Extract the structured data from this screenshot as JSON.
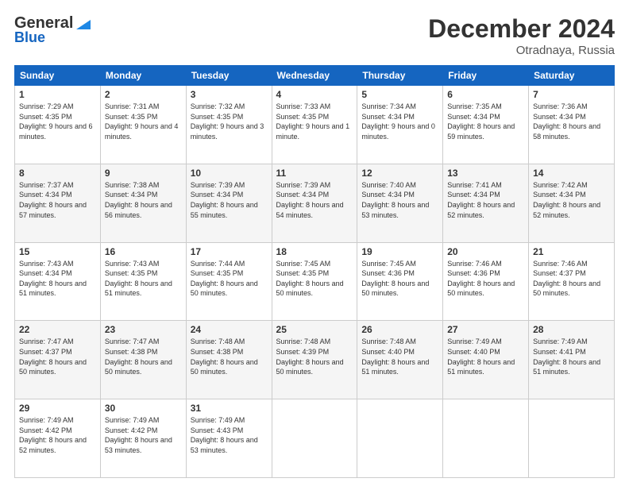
{
  "header": {
    "logo_general": "General",
    "logo_blue": "Blue",
    "month_title": "December 2024",
    "location": "Otradnaya, Russia"
  },
  "weekdays": [
    "Sunday",
    "Monday",
    "Tuesday",
    "Wednesday",
    "Thursday",
    "Friday",
    "Saturday"
  ],
  "weeks": [
    [
      {
        "day": "1",
        "sunrise": "7:29 AM",
        "sunset": "4:35 PM",
        "daylight": "9 hours and 6 minutes."
      },
      {
        "day": "2",
        "sunrise": "7:31 AM",
        "sunset": "4:35 PM",
        "daylight": "9 hours and 4 minutes."
      },
      {
        "day": "3",
        "sunrise": "7:32 AM",
        "sunset": "4:35 PM",
        "daylight": "9 hours and 3 minutes."
      },
      {
        "day": "4",
        "sunrise": "7:33 AM",
        "sunset": "4:35 PM",
        "daylight": "9 hours and 1 minute."
      },
      {
        "day": "5",
        "sunrise": "7:34 AM",
        "sunset": "4:34 PM",
        "daylight": "9 hours and 0 minutes."
      },
      {
        "day": "6",
        "sunrise": "7:35 AM",
        "sunset": "4:34 PM",
        "daylight": "8 hours and 59 minutes."
      },
      {
        "day": "7",
        "sunrise": "7:36 AM",
        "sunset": "4:34 PM",
        "daylight": "8 hours and 58 minutes."
      }
    ],
    [
      {
        "day": "8",
        "sunrise": "7:37 AM",
        "sunset": "4:34 PM",
        "daylight": "8 hours and 57 minutes."
      },
      {
        "day": "9",
        "sunrise": "7:38 AM",
        "sunset": "4:34 PM",
        "daylight": "8 hours and 56 minutes."
      },
      {
        "day": "10",
        "sunrise": "7:39 AM",
        "sunset": "4:34 PM",
        "daylight": "8 hours and 55 minutes."
      },
      {
        "day": "11",
        "sunrise": "7:39 AM",
        "sunset": "4:34 PM",
        "daylight": "8 hours and 54 minutes."
      },
      {
        "day": "12",
        "sunrise": "7:40 AM",
        "sunset": "4:34 PM",
        "daylight": "8 hours and 53 minutes."
      },
      {
        "day": "13",
        "sunrise": "7:41 AM",
        "sunset": "4:34 PM",
        "daylight": "8 hours and 52 minutes."
      },
      {
        "day": "14",
        "sunrise": "7:42 AM",
        "sunset": "4:34 PM",
        "daylight": "8 hours and 52 minutes."
      }
    ],
    [
      {
        "day": "15",
        "sunrise": "7:43 AM",
        "sunset": "4:34 PM",
        "daylight": "8 hours and 51 minutes."
      },
      {
        "day": "16",
        "sunrise": "7:43 AM",
        "sunset": "4:35 PM",
        "daylight": "8 hours and 51 minutes."
      },
      {
        "day": "17",
        "sunrise": "7:44 AM",
        "sunset": "4:35 PM",
        "daylight": "8 hours and 50 minutes."
      },
      {
        "day": "18",
        "sunrise": "7:45 AM",
        "sunset": "4:35 PM",
        "daylight": "8 hours and 50 minutes."
      },
      {
        "day": "19",
        "sunrise": "7:45 AM",
        "sunset": "4:36 PM",
        "daylight": "8 hours and 50 minutes."
      },
      {
        "day": "20",
        "sunrise": "7:46 AM",
        "sunset": "4:36 PM",
        "daylight": "8 hours and 50 minutes."
      },
      {
        "day": "21",
        "sunrise": "7:46 AM",
        "sunset": "4:37 PM",
        "daylight": "8 hours and 50 minutes."
      }
    ],
    [
      {
        "day": "22",
        "sunrise": "7:47 AM",
        "sunset": "4:37 PM",
        "daylight": "8 hours and 50 minutes."
      },
      {
        "day": "23",
        "sunrise": "7:47 AM",
        "sunset": "4:38 PM",
        "daylight": "8 hours and 50 minutes."
      },
      {
        "day": "24",
        "sunrise": "7:48 AM",
        "sunset": "4:38 PM",
        "daylight": "8 hours and 50 minutes."
      },
      {
        "day": "25",
        "sunrise": "7:48 AM",
        "sunset": "4:39 PM",
        "daylight": "8 hours and 50 minutes."
      },
      {
        "day": "26",
        "sunrise": "7:48 AM",
        "sunset": "4:40 PM",
        "daylight": "8 hours and 51 minutes."
      },
      {
        "day": "27",
        "sunrise": "7:49 AM",
        "sunset": "4:40 PM",
        "daylight": "8 hours and 51 minutes."
      },
      {
        "day": "28",
        "sunrise": "7:49 AM",
        "sunset": "4:41 PM",
        "daylight": "8 hours and 51 minutes."
      }
    ],
    [
      {
        "day": "29",
        "sunrise": "7:49 AM",
        "sunset": "4:42 PM",
        "daylight": "8 hours and 52 minutes."
      },
      {
        "day": "30",
        "sunrise": "7:49 AM",
        "sunset": "4:42 PM",
        "daylight": "8 hours and 53 minutes."
      },
      {
        "day": "31",
        "sunrise": "7:49 AM",
        "sunset": "4:43 PM",
        "daylight": "8 hours and 53 minutes."
      },
      null,
      null,
      null,
      null
    ]
  ],
  "labels": {
    "sunrise": "Sunrise: ",
    "sunset": "Sunset: ",
    "daylight": "Daylight: "
  }
}
